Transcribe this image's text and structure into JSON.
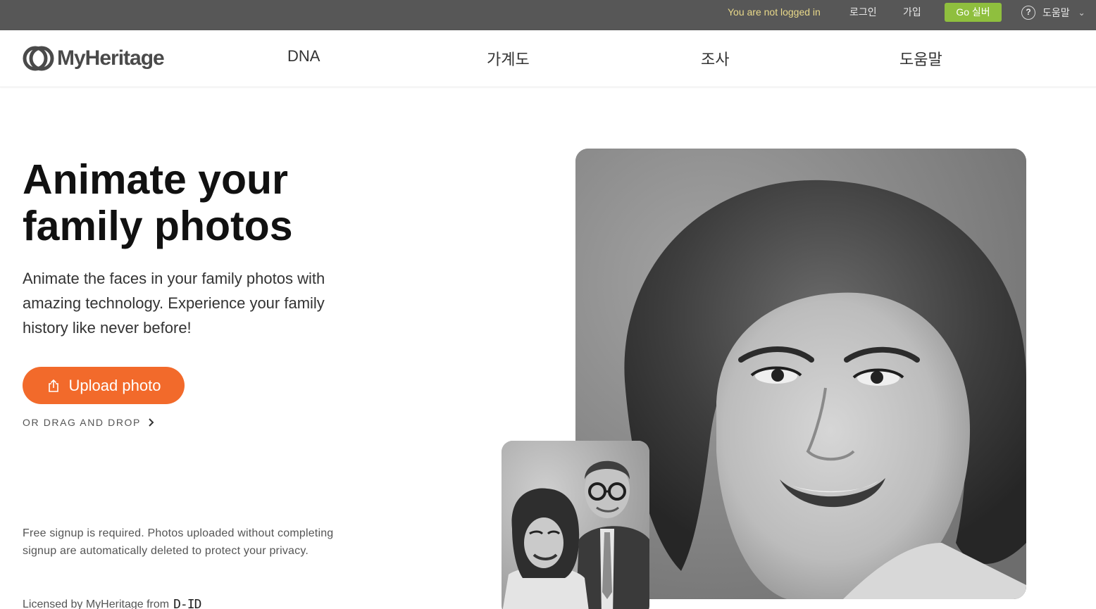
{
  "topbar": {
    "status": "You are not logged in",
    "login": "로그인",
    "signup": "가입",
    "go_silver": "Go 실버",
    "help": "도움말"
  },
  "brand": {
    "name": "MyHeritage"
  },
  "nav": {
    "items": [
      {
        "label": "DNA"
      },
      {
        "label": "가계도"
      },
      {
        "label": "조사"
      },
      {
        "label": "도움말"
      }
    ]
  },
  "hero": {
    "title_line1": "Animate your",
    "title_line2": "family photos",
    "subtitle": "Animate the faces in your family photos with amazing technology. Experience your family history like never before!",
    "upload_label": "Upload photo",
    "drag_drop": "OR DRAG AND DROP",
    "disclaimer": "Free signup is required. Photos uploaded without completing signup are automatically deleted to protect your privacy.",
    "licensed": "Licensed by MyHeritage from",
    "licensor_logo": "D-ID"
  },
  "icons": {
    "help": "help-circle-icon",
    "dropdown": "chevron-down-icon",
    "upload": "upload-icon",
    "arrow": "chevron-right-icon"
  },
  "colors": {
    "topbar_bg": "#575757",
    "status_text": "#e9d98a",
    "go_silver_bg": "#8fbf3e",
    "upload_button_bg": "#f26a2b"
  }
}
